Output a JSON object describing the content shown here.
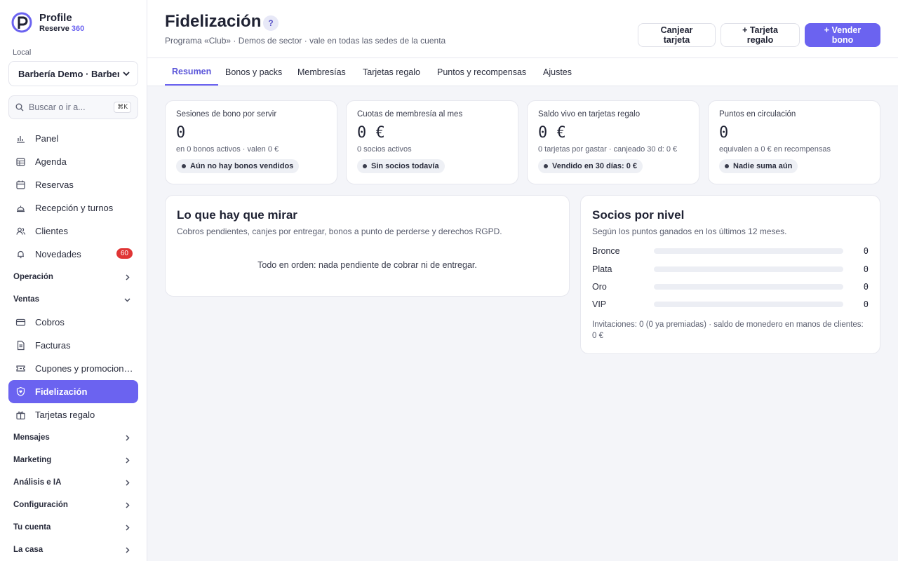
{
  "brand": {
    "name": "Profile",
    "sub": "Reserve",
    "sub_accent": "360",
    "accent_color": "#6b63f0"
  },
  "sidebar": {
    "local_label": "Local",
    "local_value": "Barbería Demo · Barbería",
    "search_placeholder": "Buscar o ir a...",
    "search_shortcut": "⌘K",
    "items": [
      {
        "label": "Panel",
        "icon": "chart-icon"
      },
      {
        "label": "Agenda",
        "icon": "grid-calendar-icon"
      },
      {
        "label": "Reservas",
        "icon": "calendar-icon"
      },
      {
        "label": "Recepción y turnos",
        "icon": "bell-desk-icon"
      },
      {
        "label": "Clientes",
        "icon": "users-icon"
      },
      {
        "label": "Novedades",
        "icon": "bell-icon",
        "badge": "60"
      }
    ],
    "sections": {
      "operacion": "Operación",
      "ventas": "Ventas",
      "mensajes": "Mensajes",
      "marketing": "Marketing",
      "analisis": "Análisis e IA",
      "configuracion": "Configuración",
      "cuenta": "Tu cuenta",
      "casa": "La casa"
    },
    "ventas_items": [
      {
        "label": "Cobros",
        "icon": "card-icon"
      },
      {
        "label": "Facturas",
        "icon": "document-icon"
      },
      {
        "label": "Cupones y promociones",
        "icon": "ticket-icon"
      },
      {
        "label": "Fidelización",
        "icon": "heart-shield-icon",
        "active": true
      },
      {
        "label": "Tarjetas regalo",
        "icon": "gift-icon"
      }
    ]
  },
  "header": {
    "title": "Fidelización",
    "help": "?",
    "subtitle": "Programa «Club» · Demos de sector · vale en todas las sedes de la cuenta",
    "buttons": {
      "redeem": "Canjear tarjeta",
      "gift": "+ Tarjeta regalo",
      "sell": "+ Vender bono"
    }
  },
  "tabs": [
    "Resumen",
    "Bonos y packs",
    "Membresías",
    "Tarjetas regalo",
    "Puntos y recompensas",
    "Ajustes"
  ],
  "stats": [
    {
      "title": "Sesiones de bono por servir",
      "value": "0",
      "detail": "en 0 bonos activos · valen 0 €",
      "pill": "Aún no hay bonos vendidos"
    },
    {
      "title": "Cuotas de membresía al mes",
      "value": "0 €",
      "detail": "0 socios activos",
      "pill": "Sin socios todavía"
    },
    {
      "title": "Saldo vivo en tarjetas regalo",
      "value": "0 €",
      "detail": "0 tarjetas por gastar · canjeado 30 d: 0 €",
      "pill": "Vendido en 30 días: 0 €"
    },
    {
      "title": "Puntos en circulación",
      "value": "0",
      "detail": "equivalen a 0 € en recompensas",
      "pill": "Nadie suma aún"
    }
  ],
  "watch": {
    "title": "Lo que hay que mirar",
    "subtitle": "Cobros pendientes, canjes por entregar, bonos a punto de perderse y derechos RGPD.",
    "empty": "Todo en orden: nada pendiente de cobrar ni de entregar."
  },
  "tiers": {
    "title": "Socios por nivel",
    "subtitle": "Según los puntos ganados en los últimos 12 meses.",
    "rows": [
      {
        "name": "Bronce",
        "count": "0",
        "fraction": 0
      },
      {
        "name": "Plata",
        "count": "0",
        "fraction": 0
      },
      {
        "name": "Oro",
        "count": "0",
        "fraction": 0
      },
      {
        "name": "VIP",
        "count": "0",
        "fraction": 0
      }
    ],
    "footer": "Invitaciones: 0 (0 ya premiadas) · saldo de monedero en manos de clientes: 0 €"
  }
}
